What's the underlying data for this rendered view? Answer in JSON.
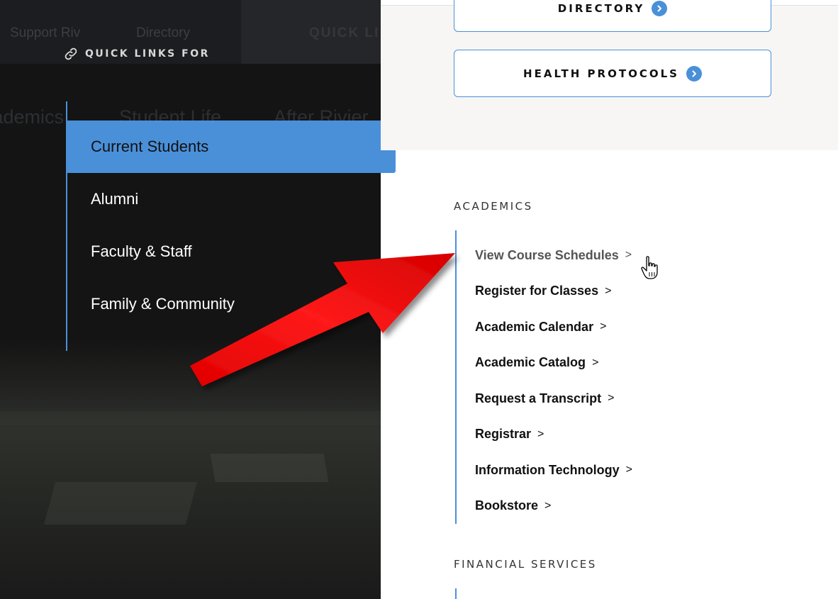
{
  "colors": {
    "accent_blue": "#4a90d9",
    "dark_panel": "#141414",
    "light_panel": "#f7f6f4",
    "arrow_red": "#ff0000"
  },
  "background_nav": {
    "top_items": [
      "Support Riv",
      "Directory",
      "QUICK LI"
    ],
    "main_items": [
      "Academics",
      "Student Life",
      "After Rivier"
    ]
  },
  "quick_links": {
    "header": "QUICK LINKS FOR",
    "header_icon": "link-icon",
    "audiences": [
      {
        "label": "Current Students",
        "active": true
      },
      {
        "label": "Alumni",
        "active": false
      },
      {
        "label": "Faculty & Staff",
        "active": false
      },
      {
        "label": "Family & Community",
        "active": false
      }
    ]
  },
  "buttons": {
    "directory": {
      "label": "DIRECTORY",
      "icon": "chevron-circle-right-icon"
    },
    "health_protocols": {
      "label": "HEALTH PROTOCOLS",
      "icon": "chevron-circle-right-icon"
    }
  },
  "sections": {
    "academics": {
      "heading": "ACADEMICS",
      "links": [
        {
          "label": "View Course Schedules",
          "hover": true
        },
        {
          "label": "Register for Classes",
          "hover": false
        },
        {
          "label": "Academic Calendar",
          "hover": false
        },
        {
          "label": "Academic Catalog",
          "hover": false
        },
        {
          "label": "Request a Transcript",
          "hover": false
        },
        {
          "label": "Registrar",
          "hover": false
        },
        {
          "label": "Information Technology",
          "hover": false
        },
        {
          "label": "Bookstore",
          "hover": false
        }
      ],
      "chevron": ">"
    },
    "financial_services": {
      "heading": "FINANCIAL SERVICES"
    }
  },
  "annotation": {
    "type": "red-arrow",
    "points_to": "View Course Schedules"
  }
}
